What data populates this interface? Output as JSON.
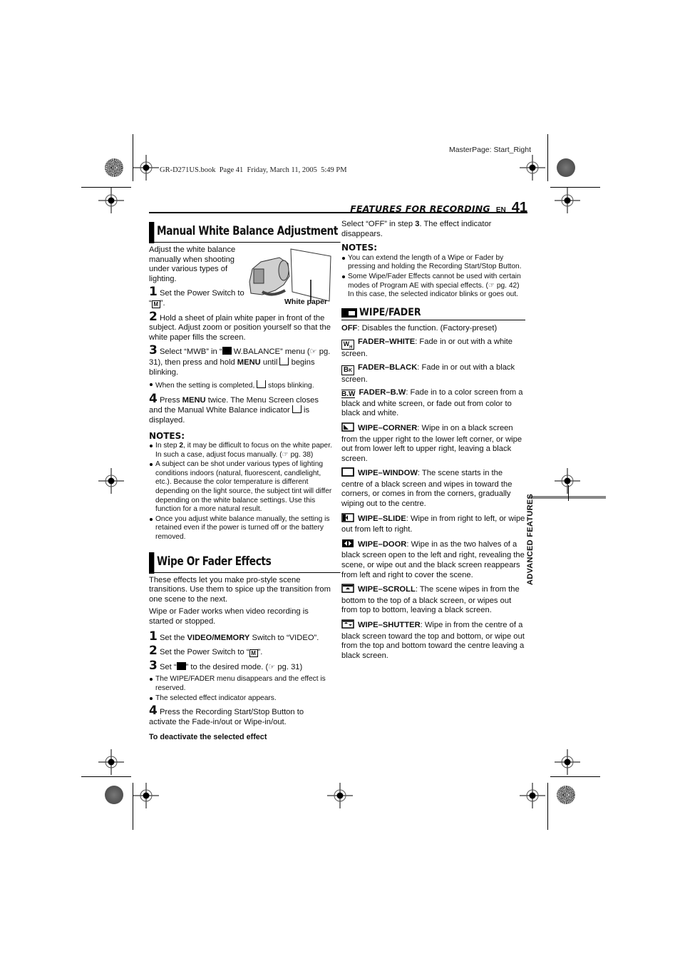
{
  "print_marks": {
    "master_page": "MasterPage: Start_Right",
    "book_slug": "GR-D271US.book  Page 41  Friday, March 11, 2005  5:49 PM"
  },
  "header": {
    "running_title": "FEATURES FOR RECORDING",
    "lang": "EN",
    "page_number": "41"
  },
  "side_tab": "ADVANCED FEATURES",
  "section_mwb": {
    "title": "Manual White Balance Adjustment",
    "intro": "Adjust the white balance manually when shooting under various types of lighting.",
    "figure_label": "White paper",
    "steps": [
      {
        "num": "1",
        "text_a": "Set the Power Switch to “",
        "icon": "M",
        "text_b": "”."
      },
      {
        "num": "2",
        "text": "Hold a sheet of plain white paper in front of the subject. Adjust zoom or position yourself so that the white paper fills the screen."
      },
      {
        "num": "3",
        "text_a": "Select “MWB” in “",
        "text_b": " W.BALANCE” menu (",
        "ref": "pg. 31",
        "text_c": "), then press and hold ",
        "bold": "MENU",
        "text_d": " until ",
        "text_e": " begins blinking."
      },
      {
        "num": "4",
        "text_a": "Press ",
        "bold": "MENU",
        "text_b": " twice. The Menu Screen closes and the Manual White Balance indicator ",
        "text_c": " is displayed."
      }
    ],
    "step3_bullet_a": "When the setting is completed, ",
    "step3_bullet_b": " stops blinking.",
    "notes_label": "NOTES:",
    "notes": [
      {
        "a": "In step ",
        "b": "2",
        "c": ", it may be difficult to focus on the white paper. In such a case, adjust focus manually. (",
        "ref": "pg. 38",
        "d": ")"
      },
      {
        "text": "A subject can be shot under various types of lighting conditions indoors (natural, fluorescent, candlelight, etc.). Because the color temperature is different depending on the light source, the subject tint will differ depending on the white balance settings. Use this function for a more natural result."
      },
      {
        "text": "Once you adjust white balance manually, the setting is retained even if the power is turned off or the battery removed."
      }
    ]
  },
  "section_wipe": {
    "title": "Wipe Or Fader Effects",
    "intro1": "These effects let you make pro-style scene transitions. Use them to spice up the transition from one scene to the next.",
    "intro2": "Wipe or Fader works when video recording is started or stopped.",
    "steps": [
      {
        "num": "1",
        "a": "Set the ",
        "bold": "VIDEO/MEMORY",
        "b": " Switch to “VIDEO”."
      },
      {
        "num": "2",
        "a": "Set the Power Switch to “",
        "icon": "M",
        "b": "”."
      },
      {
        "num": "3",
        "a": "Set “",
        "b": "” to the desired mode. (",
        "ref": "pg. 31",
        "c": ")"
      },
      {
        "num": "4",
        "text": "Press the Recording Start/Stop Button to activate the Fade-in/out or Wipe-in/out."
      }
    ],
    "step3_bullets": [
      "The WIPE/FADER menu disappears and the effect is reserved.",
      "The selected effect indicator appears."
    ],
    "deactivate_heading": "To deactivate the selected effect",
    "deactivate_a": "Select “OFF” in step ",
    "deactivate_b": "3",
    "deactivate_c": ". The effect indicator disappears.",
    "notes_label": "NOTES:",
    "notes": [
      {
        "text": "You can extend the length of a Wipe or Fader by pressing and holding the Recording Start/Stop Button."
      },
      {
        "a": "Some Wipe/Fader Effects cannot be used with certain modes of Program AE with special effects. (",
        "ref": "pg. 42",
        "b": ") In this case, the selected indicator blinks or goes out."
      }
    ]
  },
  "wipe_fader_menu": {
    "title": "WIPE/FADER",
    "options": [
      {
        "icon": "none",
        "name": "OFF",
        "desc": ": Disables the function. (Factory-preset)"
      },
      {
        "icon": "WH",
        "name": "FADER–WHITE",
        "desc": ": Fade in or out with a white screen."
      },
      {
        "icon": "BK",
        "name": "FADER–BLACK",
        "desc": ": Fade in or out with a black screen."
      },
      {
        "icon": "BW",
        "name": "FADER–B.W",
        "desc": ": Fade in to a color screen from a black and white screen, or fade out from color to black and white."
      },
      {
        "icon": "corner",
        "name": "WIPE–CORNER",
        "desc": ": Wipe in on a black screen from the upper right to the lower left corner, or wipe out from lower left to upper right, leaving a black screen."
      },
      {
        "icon": "window",
        "name": "WIPE–WINDOW",
        "desc": ": The scene starts in the centre of a black screen and wipes in toward the corners, or comes in from the corners, gradually wiping out to the centre."
      },
      {
        "icon": "slide",
        "name": "WIPE–SLIDE",
        "desc": ": Wipe in from right to left, or wipe out from left to right."
      },
      {
        "icon": "door",
        "name": "WIPE–DOOR",
        "desc": ": Wipe in as the two halves of a black screen open to the left and right, revealing the scene, or wipe out and the black screen reappears from left and right to cover the scene."
      },
      {
        "icon": "scroll",
        "name": "WIPE–SCROLL",
        "desc": ": The scene wipes in from the bottom to the top of a black screen, or wipes out from top to bottom, leaving a black screen."
      },
      {
        "icon": "shutter",
        "name": "WIPE–SHUTTER",
        "desc": ": Wipe in from the centre of a black screen toward the top and bottom, or wipe out from the top and bottom toward the centre leaving a black screen."
      }
    ]
  }
}
